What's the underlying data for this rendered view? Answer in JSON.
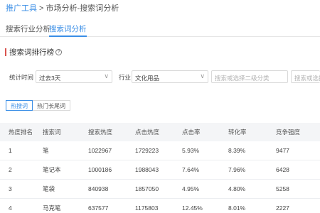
{
  "breadcrumb": {
    "root": "推广工具",
    "separator": " > ",
    "path": "市场分析-搜索词分析"
  },
  "tabs": [
    {
      "label": "搜索行业分析",
      "active": false
    },
    {
      "label": "搜索词分析",
      "active": true
    }
  ],
  "section": {
    "title": "搜索词排行榜"
  },
  "filters": {
    "time_label": "统计时间",
    "time_value": "过去3天",
    "industry_label": "行业",
    "industry_value": "文化用品",
    "sub_category_placeholder": "搜索或选择二级分类",
    "third_category_placeholder": "搜索或选择三"
  },
  "chips": [
    {
      "label": "热搜词",
      "active": true
    },
    {
      "label": "热门长尾词",
      "active": false
    }
  ],
  "table": {
    "columns": [
      "热度排名",
      "搜索词",
      "搜索热度",
      "点击热度",
      "点击率",
      "转化率",
      "竞争强度"
    ],
    "rows": [
      [
        "1",
        "笔",
        "1022967",
        "1729223",
        "5.93%",
        "8.39%",
        "9477"
      ],
      [
        "2",
        "笔记本",
        "1000186",
        "1988043",
        "7.64%",
        "7.96%",
        "6428"
      ],
      [
        "3",
        "笔袋",
        "840938",
        "1857050",
        "4.95%",
        "4.80%",
        "5258"
      ],
      [
        "4",
        "马克笔",
        "637577",
        "1175803",
        "12.45%",
        "8.01%",
        "2227"
      ]
    ]
  },
  "colors": {
    "accent": "#3a8ee6",
    "section_marker": "#d9534f",
    "header_bg": "#f4f5f7"
  },
  "icons": {
    "help": "question-circle-icon",
    "chevron": "chevron-down-icon"
  }
}
